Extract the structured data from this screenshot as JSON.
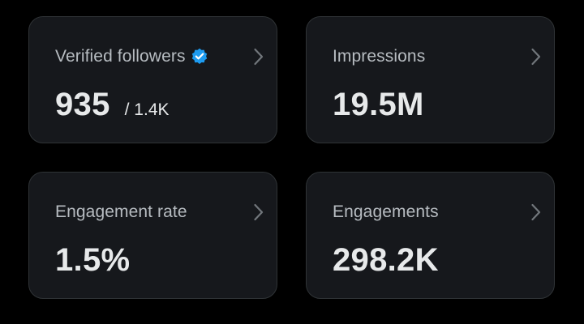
{
  "colors": {
    "background": "#000000",
    "card_background": "#16181c",
    "card_border": "#2f3336",
    "label_text": "#b7bcc1",
    "value_text": "#e7e9ea",
    "verified_badge": "#1d9bf0",
    "chevron": "#71767b"
  },
  "cards": [
    {
      "label": "Verified followers",
      "value": "935",
      "sub_value": "/ 1.4K",
      "icon": "verified-badge-icon",
      "action_icon": "chevron-right-icon"
    },
    {
      "label": "Impressions",
      "value": "19.5M",
      "action_icon": "chevron-right-icon"
    },
    {
      "label": "Engagement rate",
      "value": "1.5%",
      "action_icon": "chevron-right-icon"
    },
    {
      "label": "Engagements",
      "value": "298.2K",
      "action_icon": "chevron-right-icon"
    }
  ]
}
